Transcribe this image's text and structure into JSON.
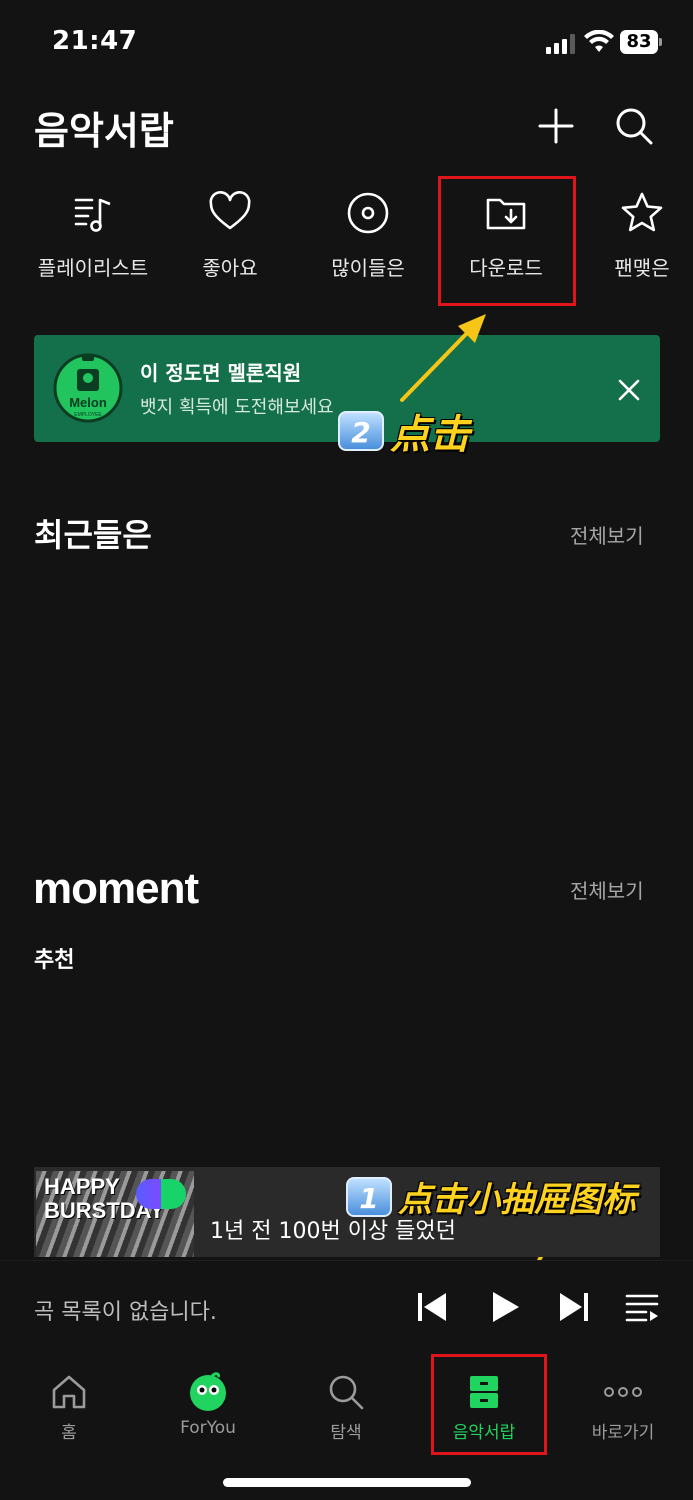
{
  "status_bar": {
    "time": "21:47",
    "battery": "83"
  },
  "header": {
    "title": "음악서랍",
    "add_icon": "plus-icon",
    "search_icon": "search-icon"
  },
  "quick_menu": [
    {
      "label": "플레이리스트",
      "icon": "playlist-music-icon"
    },
    {
      "label": "좋아요",
      "icon": "heart-icon"
    },
    {
      "label": "많이들은",
      "icon": "disc-icon"
    },
    {
      "label": "다운로드",
      "icon": "folder-download-icon"
    },
    {
      "label": "팬맺은",
      "icon": "star-icon"
    }
  ],
  "banner": {
    "title": "이 정도면 멜론직원",
    "subtitle": "뱃지 획득에 도전해보세요",
    "badge_text": "Melon",
    "badge_subtext": "EMPLOYEE",
    "background": "#14704a"
  },
  "annotations": {
    "step1": {
      "number": "1",
      "text": "点击小抽屉图标"
    },
    "step2": {
      "number": "2",
      "text": "点击"
    },
    "highlight_color": "#e0151b",
    "arrow_color": "#f5c518"
  },
  "sections": {
    "recent": {
      "title": "최근들은",
      "see_all": "전체보기"
    },
    "moment": {
      "logo": "moment",
      "see_all": "전체보기",
      "subtitle": "추천"
    }
  },
  "moment_card": {
    "thumb_text_line1": "HAPPY",
    "thumb_text_line2": "BURSTDAY",
    "text": "1년 전 100번 이상 들었던"
  },
  "player": {
    "empty_text": "곡 목록이 없습니다."
  },
  "tab_bar": [
    {
      "label": "홈",
      "icon": "home-icon"
    },
    {
      "label": "ForYou",
      "icon": "foryou-character-icon"
    },
    {
      "label": "탐색",
      "icon": "search-icon"
    },
    {
      "label": "음악서랍",
      "icon": "drawer-icon",
      "active": true
    },
    {
      "label": "바로가기",
      "icon": "more-dots-icon"
    }
  ],
  "colors": {
    "accent": "#21d45f",
    "background": "#131313"
  }
}
